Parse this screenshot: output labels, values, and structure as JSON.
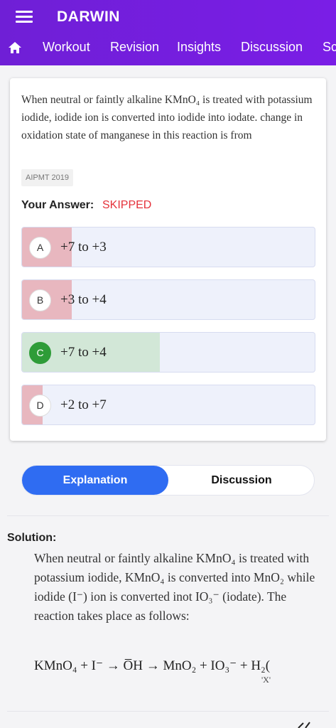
{
  "app": {
    "title": "DARWIN",
    "menu_icon": "menu-icon",
    "home_icon": "home-icon"
  },
  "nav": {
    "items": [
      "Workout",
      "Revision",
      "Insights",
      "Discussion",
      "Sc"
    ]
  },
  "question": {
    "text": "When neutral or faintly alkaline KMnO₄ is treated with potassium iodide, iodide ion is converted into iodide into iodate. change in oxidation state of manganese in this reaction is from",
    "tag": "AIPMT 2019",
    "answer_label": "Your Answer:",
    "answer_value": "SKIPPED"
  },
  "options": [
    {
      "letter": "A",
      "text": "+7 to +3",
      "percent": 17,
      "correct": false
    },
    {
      "letter": "B",
      "text": "+3 to +4",
      "percent": 17,
      "correct": false
    },
    {
      "letter": "C",
      "text": "+7 to +4",
      "percent": 47,
      "correct": true
    },
    {
      "letter": "D",
      "text": "+2 to +7",
      "percent": 7,
      "correct": false
    }
  ],
  "tabs": {
    "explanation": "Explanation",
    "discussion": "Discussion"
  },
  "solution": {
    "label": "Solution:",
    "text": "When neutral or faintly alkaline KMnO₄ is treated with potassium iodide, KMnO₄ is converted into MnO₂ while iodide (I⁻) ion is converted inot IO₃⁻ (iodate). The reaction takes place as follows:",
    "equation": "KMnO₄ + I⁻ → O̅H → MnO₂ + IO₃⁻ + H₂(",
    "equation_note": "'X'"
  },
  "colors": {
    "header": "#7a1ee6",
    "accent": "#2f6cf2",
    "wrong_fill": "#e8b7bf",
    "correct_fill": "#d2e7d7",
    "skipped": "#e5323b"
  }
}
